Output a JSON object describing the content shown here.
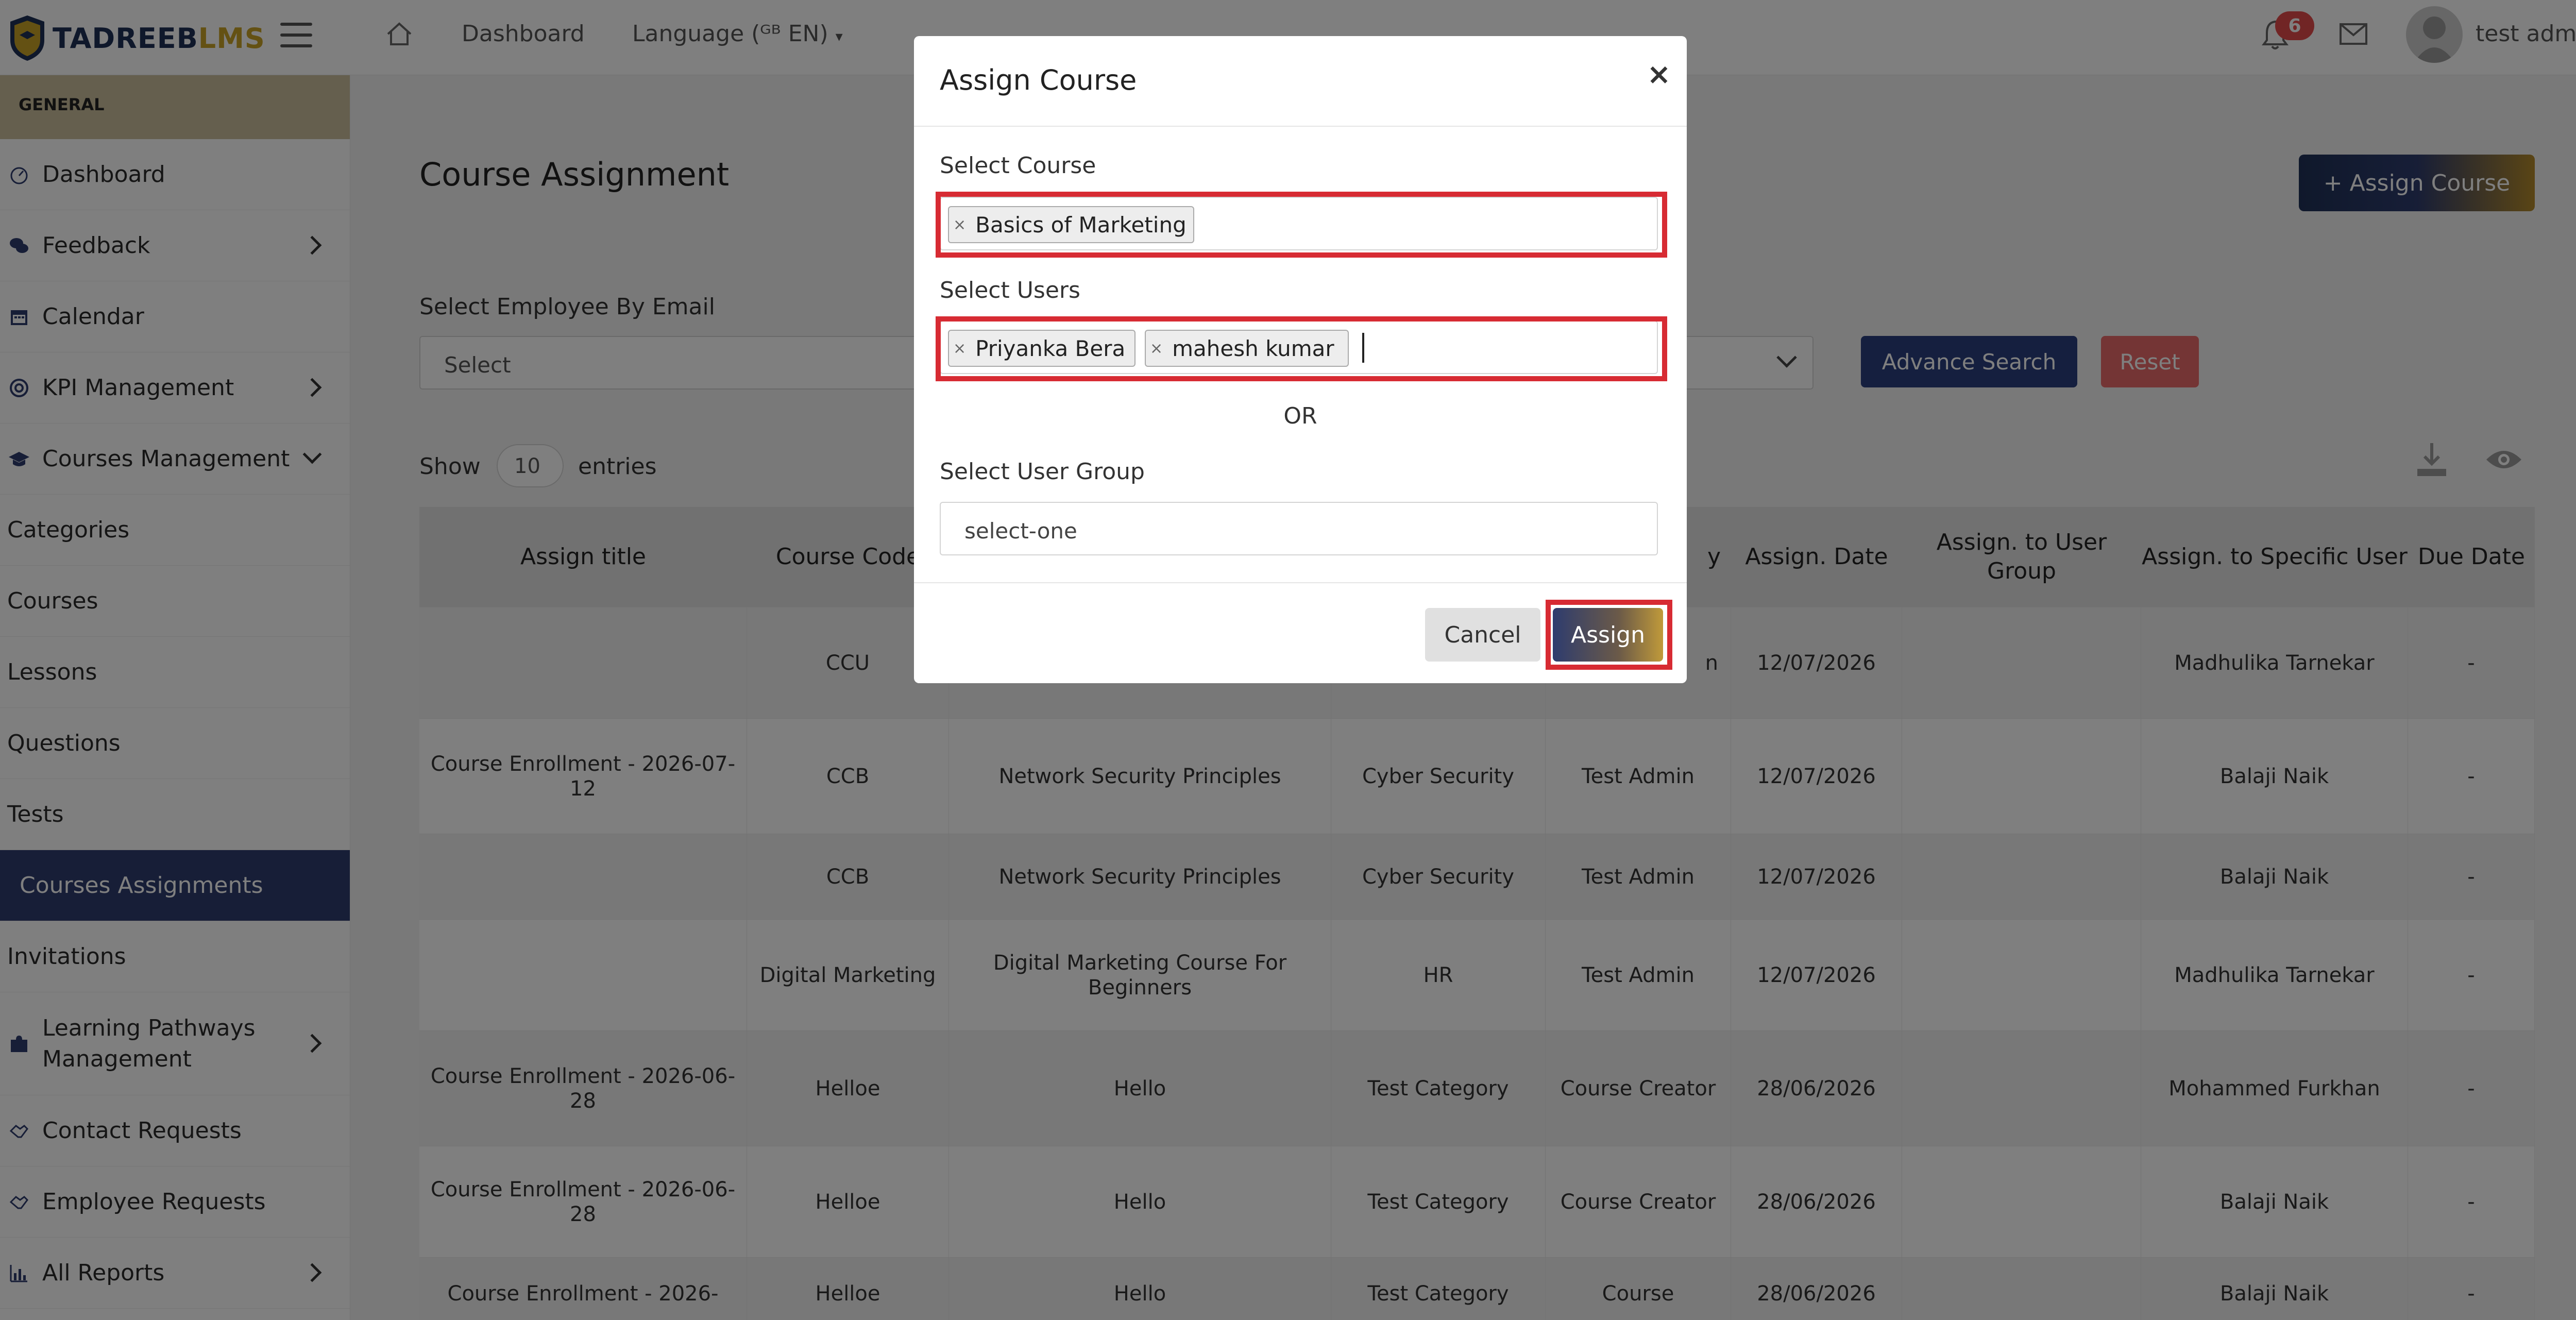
{
  "app": {
    "logo_part1": "TADREEB",
    "logo_part2": "LMS"
  },
  "topbar": {
    "nav_dashboard": "Dashboard",
    "nav_language": "Language (ᴳᴮ EN)",
    "notification_count": "6",
    "user_name": "test admin"
  },
  "sidebar": {
    "section": "GENERAL",
    "items": [
      {
        "label": "Dashboard",
        "icon": "dashboard-gauge-icon"
      },
      {
        "label": "Feedback",
        "icon": "chat-bubbles-icon"
      },
      {
        "label": "Calendar",
        "icon": "calendar-icon"
      },
      {
        "label": "KPI Management",
        "icon": "target-icon"
      },
      {
        "label": "Courses Management",
        "icon": "graduation-cap-icon"
      },
      {
        "label": "Categories"
      },
      {
        "label": "Courses"
      },
      {
        "label": "Lessons"
      },
      {
        "label": "Questions"
      },
      {
        "label": "Tests"
      },
      {
        "label": "Courses Assignments"
      },
      {
        "label": "Invitations"
      },
      {
        "label": "Learning Pathways Management",
        "icon": "puzzle-icon"
      },
      {
        "label": "Contact Requests",
        "icon": "handshake-icon"
      },
      {
        "label": "Employee Requests",
        "icon": "handshake-icon"
      },
      {
        "label": "All Reports",
        "icon": "bar-chart-icon"
      }
    ]
  },
  "page": {
    "title": "Course Assignment",
    "assign_button": "+ Assign Course",
    "filter_label": "Select Employee By Email",
    "filter_placeholder": "Select",
    "advance_search": "Advance Search",
    "reset": "Reset",
    "show_label": "Show",
    "show_value": "10",
    "entries_label": "entries"
  },
  "table": {
    "headers": [
      "Assign title",
      "Course Code",
      "",
      "",
      "y",
      "Assign. Date",
      "Assign. to User Group",
      "Assign. to Specific User",
      "Due Date"
    ],
    "rows": [
      [
        "",
        "CCU",
        "",
        "",
        "n",
        "12/07/2026",
        "",
        "Madhulika Tarnekar",
        "-"
      ],
      [
        "Course Enrollment - 2026-07-12",
        "CCB",
        "Network Security Principles",
        "Cyber Security",
        "Test Admin",
        "12/07/2026",
        "",
        "Balaji Naik",
        "-"
      ],
      [
        "",
        "CCB",
        "Network Security Principles",
        "Cyber Security",
        "Test Admin",
        "12/07/2026",
        "",
        "Balaji Naik",
        "-"
      ],
      [
        "",
        "Digital Marketing",
        "Digital Marketing Course For Beginners",
        "HR",
        "Test Admin",
        "12/07/2026",
        "",
        "Madhulika Tarnekar",
        "-"
      ],
      [
        "Course Enrollment - 2026-06-28",
        "Helloe",
        "Hello",
        "Test Category",
        "Course Creator",
        "28/06/2026",
        "",
        "Mohammed Furkhan",
        "-"
      ],
      [
        "Course Enrollment - 2026-06-28",
        "Helloe",
        "Hello",
        "Test Category",
        "Course Creator",
        "28/06/2026",
        "",
        "Balaji Naik",
        "-"
      ],
      [
        "Course Enrollment - 2026-",
        "Helloe",
        "Hello",
        "Test Category",
        "Course",
        "28/06/2026",
        "",
        "Balaji Naik",
        "-"
      ]
    ]
  },
  "modal": {
    "title": "Assign Course",
    "close": "×",
    "course_label": "Select Course",
    "course_chips": [
      "Basics of Marketing"
    ],
    "users_label": "Select Users",
    "user_chips": [
      "Priyanka Bera",
      "mahesh kumar"
    ],
    "chip_remove": "×",
    "or_label": "OR",
    "group_label": "Select User Group",
    "group_value": "select-one",
    "cancel": "Cancel",
    "submit": "Assign"
  },
  "colors": {
    "brand_navy": "#1f3157",
    "brand_gold": "#c9a227",
    "highlight_red": "#d72b33",
    "badge_red": "#e34b4b",
    "sidebar_active": "#2e3c6e"
  }
}
